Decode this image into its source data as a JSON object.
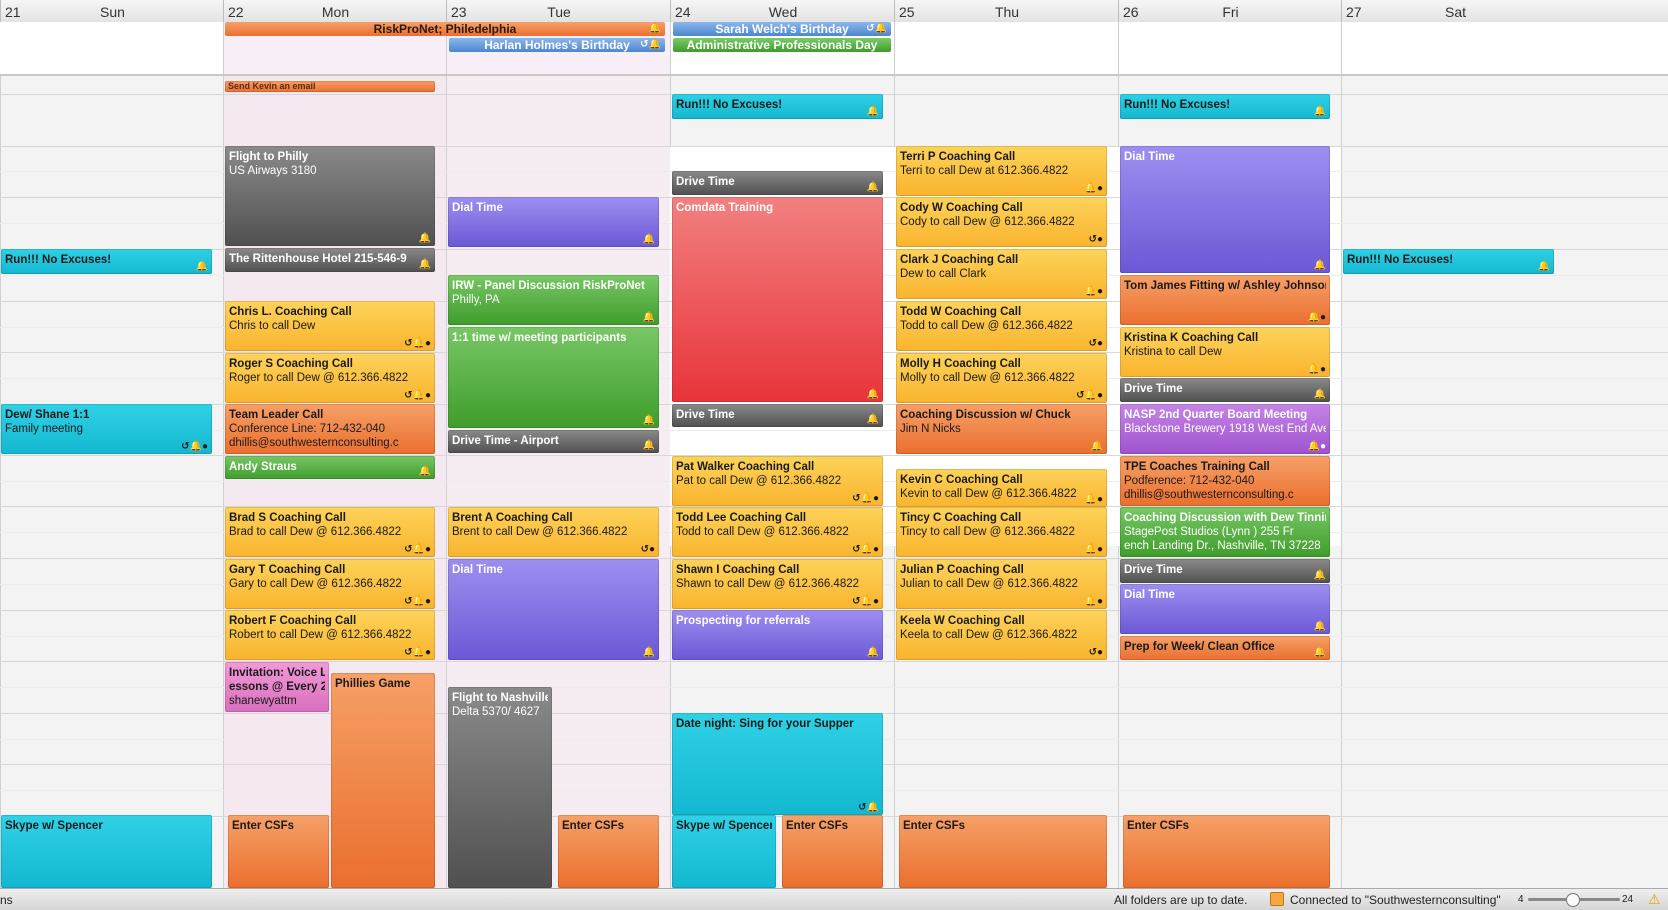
{
  "days": [
    {
      "num": "21",
      "name": "Sun"
    },
    {
      "num": "22",
      "name": "Mon"
    },
    {
      "num": "23",
      "name": "Tue"
    },
    {
      "num": "24",
      "name": "Wed"
    },
    {
      "num": "25",
      "name": "Thu"
    },
    {
      "num": "26",
      "name": "Fri"
    },
    {
      "num": "27",
      "name": "Sat"
    }
  ],
  "allday": {
    "riskpronet": "RiskProNet; Philedelphia",
    "sarah": "Sarah Welch's Birthday",
    "harlan": "Harlan Holmes's Birthday",
    "admin": "Administrative Professionals Day"
  },
  "events": {
    "send_kevin": "Send Kevin an email",
    "run_wed": "Run!!! No Excuses!",
    "run_fri": "Run!!! No Excuses!",
    "run_sun": "Run!!! No Excuses!",
    "run_sat": "Run!!! No Excuses!",
    "flight_philly": {
      "title": "Flight to Philly",
      "sub": "US Airways 3180"
    },
    "rittenhouse": "The Rittenhouse Hotel 215-546-9",
    "dial_tue": "Dial Time",
    "drive_wed_1": "Drive Time",
    "comdata": "Comdata Training",
    "drive_wed_2": "Drive Time",
    "terri": {
      "title": "Terri P         Coaching Call",
      "sub": "Terri to call Dew at 612.366.4822"
    },
    "cody": {
      "title": "Cody W        Coaching Call",
      "sub": "Cody to call Dew @ 612.366.4822"
    },
    "clark": {
      "title": "Clark J          Coaching Call",
      "sub": "Dew to call Clark"
    },
    "todd_w": {
      "title": "Todd W          Coaching Call",
      "sub": "Todd to call Dew @ 612.366.4822"
    },
    "molly": {
      "title": "Molly H          Coaching Call",
      "sub": "Molly to call Dew @ 612.366.4822"
    },
    "coaching_chuck": {
      "title": "Coaching Discussion w/ Chuck",
      "sub": "Jim N Nicks"
    },
    "dial_fri": "Dial Time",
    "tom_james": "Tom James Fitting w/ Ashley Johnson",
    "kristina": {
      "title": "Kristina K      Coaching Call",
      "sub": "Kristina to call Dew"
    },
    "drive_fri_1": "Drive Time",
    "nasp": {
      "title": "NASP 2nd Quarter Board Meeting",
      "sub": "Blackstone Brewery 1918 West End Ave,"
    },
    "irw": {
      "title": "IRW - Panel Discussion RiskProNet",
      "sub": "Philly, PA"
    },
    "one_on_one": "1:1 time w/ meeting participants",
    "drive_airport": "Drive Time - Airport",
    "chris": {
      "title": "Chris L.       Coaching Call",
      "sub": "Chris to call Dew"
    },
    "roger": {
      "title": "Roger S           Coaching Call",
      "sub": "Roger to call Dew @ 612.366.4822"
    },
    "team_leader": {
      "title": "Team Leader Call",
      "sub": "Conference Line: 712-432-040",
      "sub2": "dhillis@southwesternconsulting.c"
    },
    "dew_shane": {
      "title": "Dew/ Shane 1:1",
      "sub": "Family meeting"
    },
    "andy": "Andy Straus",
    "pat": {
      "title": "Pat Walker Coaching Call",
      "sub": "Pat to call Dew @ 612.366.4822"
    },
    "kevin_c": {
      "title": "Kevin C          Coaching Call",
      "sub": "Kevin to call Dew @ 612.366.4822"
    },
    "tpe": {
      "title": "TPE Coaches Training Call",
      "sub": "Podference: 712-432-040",
      "sub2": "dhillis@southwesternconsulting.c"
    },
    "brad": {
      "title": "Brad S              Coaching Call",
      "sub": "Brad to call Dew @ 612.366.4822"
    },
    "brent": {
      "title": "Brent A               Coaching Call",
      "sub": "Brent to call Dew @ 612.366.4822"
    },
    "todd_lee": {
      "title": "Todd Lee Coaching Call",
      "sub": "Todd to call Dew @ 612.366.4822"
    },
    "tincy": {
      "title": "Tincy C           Coaching Call",
      "sub": "Tincy to call Dew @ 612.366.4822"
    },
    "coaching_tinnin": {
      "title": "Coaching Discussion with Dew Tinnin",
      "sub": "StagePost Studios (Lynn           ) 255 Fr",
      "sub2": "ench Landing Dr., Nashville, TN 37228"
    },
    "gary": {
      "title": "Gary T              Coaching Call",
      "sub": "Gary to call Dew @ 612.366.4822"
    },
    "dial_tue_2": "Dial Time",
    "shawn": {
      "title": "Shawn I           Coaching Call",
      "sub": "Shawn to call Dew @ 612.366.4822"
    },
    "julian": {
      "title": "Julian P           Coaching Call",
      "sub": "Julian to call Dew @ 612.366.4822"
    },
    "drive_fri_2": "Drive Time",
    "dial_fri_2": "Dial Time",
    "robert": {
      "title": "Robert F           Coaching Call",
      "sub": "Robert to call Dew @ 612.366.4822"
    },
    "prospecting": "Prospecting for referrals",
    "keela": {
      "title": "Keela W          Coaching Call",
      "sub": "Keela to call Dew @ 612.366.4822"
    },
    "prep_week": "Prep for Week/ Clean Office",
    "invitation": {
      "title": "Invitation: Voice L",
      "sub": "essons @ Every 2",
      "sub2": "shanewyattm"
    },
    "phillies": "Phillies Game",
    "flight_nash": {
      "title": "Flight to Nashville",
      "sub": "Delta 5370/ 4627"
    },
    "date_night": "Date night: Sing for your Supper",
    "skype_sun": "Skype w/ Spencer",
    "enter_mon": "Enter CSFs",
    "enter_tue": "Enter CSFs",
    "skype_wed": "Skype w/ Spencer",
    "enter_wed": "Enter CSFs",
    "enter_thu": "Enter CSFs",
    "enter_fri": "Enter CSFs"
  },
  "status": {
    "left": "ns",
    "message": "All folders are up to date.",
    "connection": "Connected to \"Southwesternconsulting\"",
    "zoom_min": "4",
    "zoom_max": "24"
  },
  "colors": {
    "cyan": "#13b8d0",
    "gray": "#505050",
    "purple": "#6c58d6",
    "red": "#e8343a",
    "green": "#3f9d2b",
    "yellow": "#f9b42e",
    "orange": "#ea6f2e",
    "pink": "#d86fbd",
    "violet": "#9f52cf"
  },
  "icons": {
    "bell": "bell-icon",
    "people": "attendees-icon",
    "repeat": "repeat-icon"
  }
}
